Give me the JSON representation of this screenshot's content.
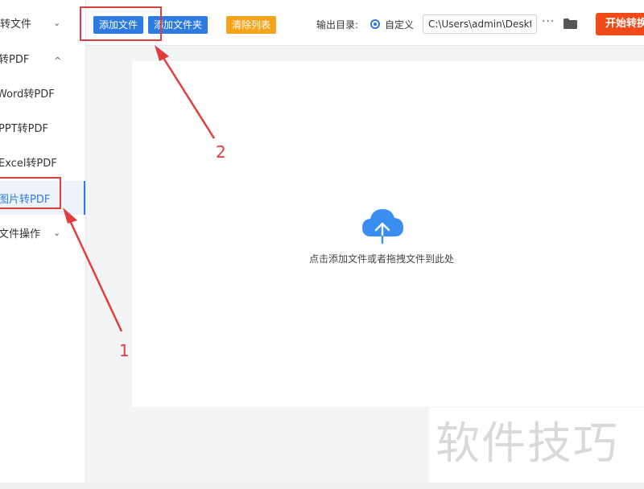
{
  "sidebar": {
    "items": [
      {
        "label": "转文件",
        "chevron": "⌄"
      },
      {
        "label": "转PDF",
        "chevron": "^"
      },
      {
        "label": "Word转PDF"
      },
      {
        "label": "PPT转PDF"
      },
      {
        "label": "Excel转PDF"
      },
      {
        "label": "图片转PDF"
      },
      {
        "label": "文件操作",
        "chevron": "⌄"
      }
    ]
  },
  "toolbar": {
    "add_file_label": "添加文件",
    "add_folder_label": "添加文件夹",
    "clear_list_label": "清除列表",
    "output_dir_label": "输出目录:",
    "custom_label": "自定义",
    "path_value": "C:\\Users\\admin\\Deskto",
    "more_label": "···",
    "start_label": "开始转换"
  },
  "dropzone": {
    "hint": "点击添加文件或者拖拽文件到此处"
  },
  "annotations": {
    "label_1": "1",
    "label_2": "2"
  },
  "watermark": "软件技巧",
  "colors": {
    "accent_blue": "#2e7be0",
    "orange": "#f5a31a",
    "start_red": "#f04a18",
    "annotation_red": "#e23c3c"
  }
}
